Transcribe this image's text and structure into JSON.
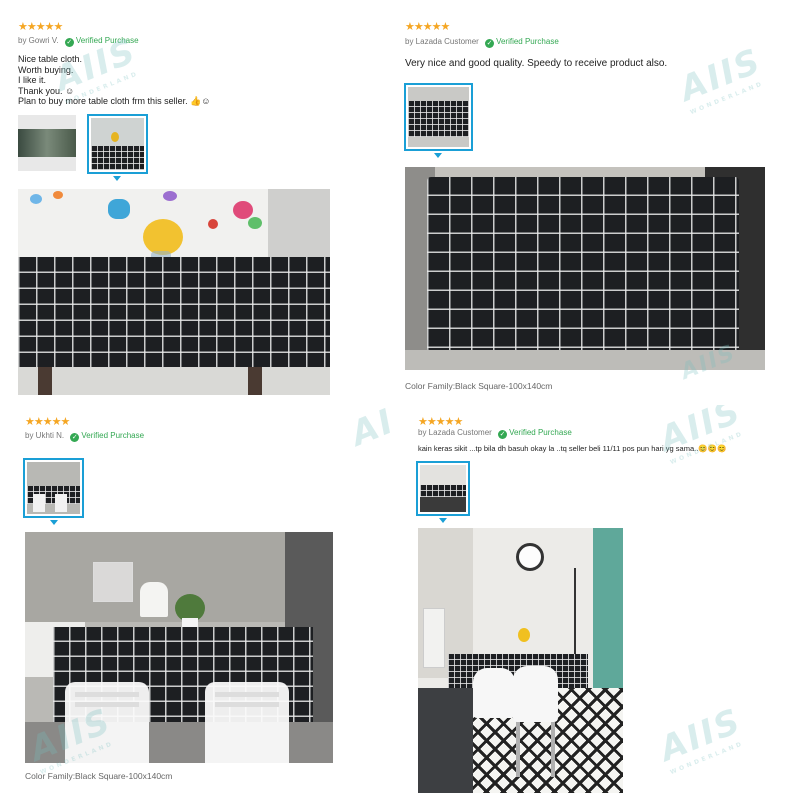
{
  "reviews": [
    {
      "stars": "★★★★★",
      "by": "by Gowri V.",
      "verified": "Verified Purchase",
      "text_lines": [
        "Nice table cloth.",
        "Worth buying.",
        "I like it.",
        "Thank you. ☺",
        "Plan to buy more table cloth frm this seller. 👍☺"
      ],
      "caption": ""
    },
    {
      "stars": "★★★★★",
      "by": "by Lazada Customer",
      "verified": "Verified Purchase",
      "text_lines": [
        "Very nice and good quality. Speedy to receive product also."
      ],
      "caption": "Color Family:Black Square-100x140cm"
    },
    {
      "stars": "★★★★★",
      "by": "by Ukhti N.",
      "verified": "Verified Purchase",
      "text_lines": [],
      "caption": "Color Family:Black Square-100x140cm"
    },
    {
      "stars": "★★★★★",
      "by": "by Lazada Customer",
      "verified": "Verified Purchase",
      "text_lines": [
        "kain keras sikit ...tp bila dh basuh okay la ..tq seller beli 11/11 pos pun hari yg sama..😊😊😊"
      ],
      "caption": ""
    }
  ],
  "watermark": {
    "brand": "AIIS",
    "tagline": "WONDERLAND"
  },
  "icons": {
    "check": "check-circle-icon",
    "arrow": "caret-down-icon"
  },
  "colors": {
    "star": "#f5a623",
    "verified": "#34a853",
    "thumb_border": "#1a9fd6"
  }
}
